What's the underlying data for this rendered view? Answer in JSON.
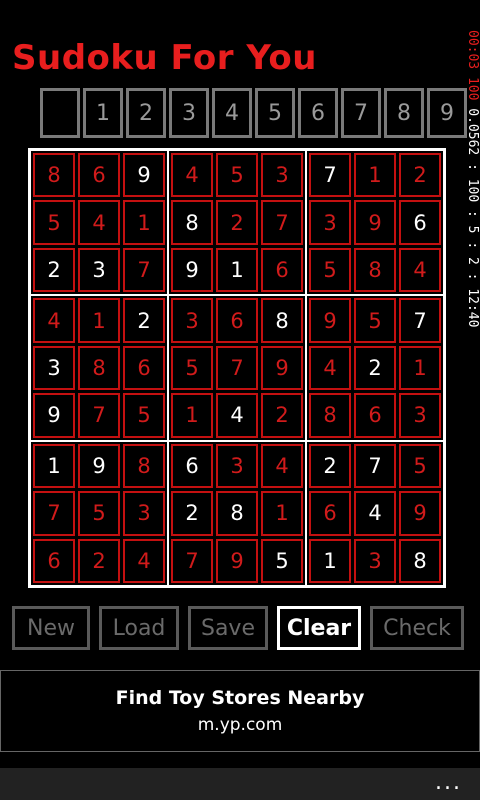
{
  "app": {
    "title": "Sudoku For You"
  },
  "side_info": {
    "red_text": "00:03 100",
    "white_text": "0.0562 : 100 : 5 : 2 : 12:40"
  },
  "numpad": [
    "",
    "1",
    "2",
    "3",
    "4",
    "5",
    "6",
    "7",
    "8",
    "9"
  ],
  "board": {
    "rows": [
      [
        {
          "v": "8",
          "g": false
        },
        {
          "v": "6",
          "g": false
        },
        {
          "v": "9",
          "g": true
        },
        {
          "v": "4",
          "g": false
        },
        {
          "v": "5",
          "g": false
        },
        {
          "v": "3",
          "g": false
        },
        {
          "v": "7",
          "g": true
        },
        {
          "v": "1",
          "g": false
        },
        {
          "v": "2",
          "g": false
        }
      ],
      [
        {
          "v": "5",
          "g": false
        },
        {
          "v": "4",
          "g": false
        },
        {
          "v": "1",
          "g": false
        },
        {
          "v": "8",
          "g": true
        },
        {
          "v": "2",
          "g": false
        },
        {
          "v": "7",
          "g": false
        },
        {
          "v": "3",
          "g": false
        },
        {
          "v": "9",
          "g": false
        },
        {
          "v": "6",
          "g": true
        }
      ],
      [
        {
          "v": "2",
          "g": true
        },
        {
          "v": "3",
          "g": true
        },
        {
          "v": "7",
          "g": false
        },
        {
          "v": "9",
          "g": true
        },
        {
          "v": "1",
          "g": true
        },
        {
          "v": "6",
          "g": false
        },
        {
          "v": "5",
          "g": false
        },
        {
          "v": "8",
          "g": false
        },
        {
          "v": "4",
          "g": false
        }
      ],
      [
        {
          "v": "4",
          "g": false
        },
        {
          "v": "1",
          "g": false
        },
        {
          "v": "2",
          "g": true
        },
        {
          "v": "3",
          "g": false
        },
        {
          "v": "6",
          "g": false
        },
        {
          "v": "8",
          "g": true
        },
        {
          "v": "9",
          "g": false
        },
        {
          "v": "5",
          "g": false
        },
        {
          "v": "7",
          "g": true
        }
      ],
      [
        {
          "v": "3",
          "g": true
        },
        {
          "v": "8",
          "g": false
        },
        {
          "v": "6",
          "g": false
        },
        {
          "v": "5",
          "g": false
        },
        {
          "v": "7",
          "g": false
        },
        {
          "v": "9",
          "g": false
        },
        {
          "v": "4",
          "g": false
        },
        {
          "v": "2",
          "g": true
        },
        {
          "v": "1",
          "g": false
        }
      ],
      [
        {
          "v": "9",
          "g": true
        },
        {
          "v": "7",
          "g": false
        },
        {
          "v": "5",
          "g": false
        },
        {
          "v": "1",
          "g": false
        },
        {
          "v": "4",
          "g": true
        },
        {
          "v": "2",
          "g": false
        },
        {
          "v": "8",
          "g": false
        },
        {
          "v": "6",
          "g": false
        },
        {
          "v": "3",
          "g": false
        }
      ],
      [
        {
          "v": "1",
          "g": true
        },
        {
          "v": "9",
          "g": true
        },
        {
          "v": "8",
          "g": false
        },
        {
          "v": "6",
          "g": true
        },
        {
          "v": "3",
          "g": false
        },
        {
          "v": "4",
          "g": false
        },
        {
          "v": "2",
          "g": true
        },
        {
          "v": "7",
          "g": true
        },
        {
          "v": "5",
          "g": false
        }
      ],
      [
        {
          "v": "7",
          "g": false
        },
        {
          "v": "5",
          "g": false
        },
        {
          "v": "3",
          "g": false
        },
        {
          "v": "2",
          "g": true
        },
        {
          "v": "8",
          "g": true
        },
        {
          "v": "1",
          "g": false
        },
        {
          "v": "6",
          "g": false
        },
        {
          "v": "4",
          "g": true
        },
        {
          "v": "9",
          "g": false
        }
      ],
      [
        {
          "v": "6",
          "g": false
        },
        {
          "v": "2",
          "g": false
        },
        {
          "v": "4",
          "g": false
        },
        {
          "v": "7",
          "g": false
        },
        {
          "v": "9",
          "g": false
        },
        {
          "v": "5",
          "g": true
        },
        {
          "v": "1",
          "g": true
        },
        {
          "v": "3",
          "g": false
        },
        {
          "v": "8",
          "g": true
        }
      ]
    ]
  },
  "actions": [
    {
      "label": "New",
      "name": "new-button",
      "active": false,
      "width": 78
    },
    {
      "label": "Load",
      "name": "load-button",
      "active": false,
      "width": 80
    },
    {
      "label": "Save",
      "name": "save-button",
      "active": false,
      "width": 80
    },
    {
      "label": "Clear",
      "name": "clear-button",
      "active": true,
      "width": 84
    },
    {
      "label": "Check",
      "name": "check-button",
      "active": false,
      "width": 94
    }
  ],
  "ad": {
    "title": "Find Toy Stores Nearby",
    "subtitle": "m.yp.com"
  },
  "appbar": {
    "more_label": "..."
  },
  "colors": {
    "accent_red": "#e81e1e",
    "cell_border": "#c41010",
    "background": "#000000"
  }
}
